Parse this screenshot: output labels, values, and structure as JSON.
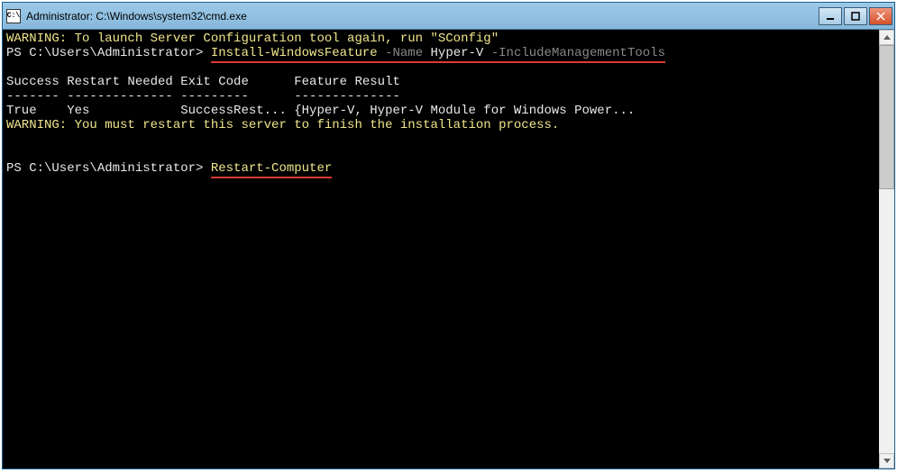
{
  "window": {
    "title": "Administrator: C:\\Windows\\system32\\cmd.exe",
    "icon_label": "C:\\"
  },
  "console": {
    "line1_warning": "WARNING: To launch Server Configuration tool again, run \"SConfig\"",
    "prompt1": "PS C:\\Users\\Administrator> ",
    "cmd1_command": "Install-WindowsFeature",
    "cmd1_sp1": " ",
    "cmd1_param1": "-Name",
    "cmd1_sp2": " ",
    "cmd1_arg1": "Hyper-V",
    "cmd1_sp3": " ",
    "cmd1_param2": "-IncludeManagementTools",
    "blank1": "",
    "header": "Success Restart Needed Exit Code      Feature Result",
    "divider": "------- -------------- ---------      --------------",
    "result_row": "True    Yes            SuccessRest... {Hyper-V, Hyper-V Module for Windows Power...",
    "line_warning2": "WARNING: You must restart this server to finish the installation process.",
    "blank2": "",
    "blank3": "",
    "prompt2": "PS C:\\Users\\Administrator> ",
    "cmd2_command": "Restart-Computer"
  }
}
